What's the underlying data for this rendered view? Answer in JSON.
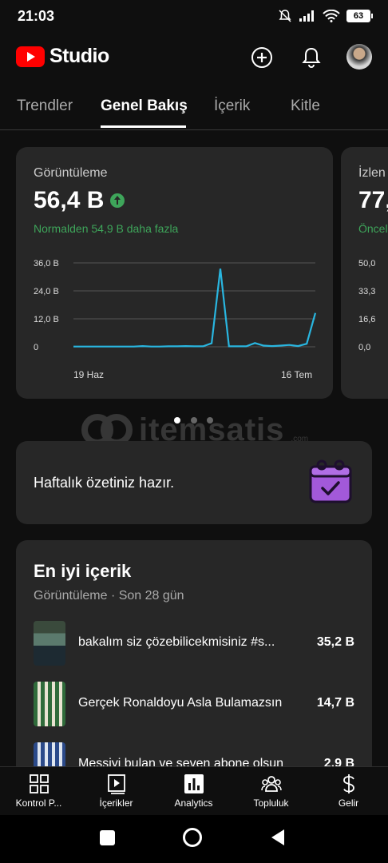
{
  "status": {
    "time": "21:03",
    "battery": "63"
  },
  "header": {
    "logo_text": "Studio"
  },
  "tabs": [
    {
      "label": "Trendler"
    },
    {
      "label": "Genel Bakış"
    },
    {
      "label": "İçerik"
    },
    {
      "label": "Kitle"
    }
  ],
  "views_card": {
    "label": "Görüntüleme",
    "value": "56,4 B",
    "note": "Normalden 54,9 B daha fazla"
  },
  "peek_card": {
    "label": "İzlen",
    "value": "77,",
    "note": "Öncel"
  },
  "chart_data": [
    {
      "type": "line",
      "title": "",
      "x_start_label": "19 Haz",
      "x_end_label": "16 Tem",
      "y_ticks": [
        "0",
        "12,0 B",
        "24,0 B",
        "36,0 B"
      ],
      "ylim": [
        0,
        36
      ],
      "grid": true,
      "color": "#29b6e0",
      "series": [
        {
          "values": [
            0.1,
            0.1,
            0.1,
            0.1,
            0.1,
            0.1,
            0.1,
            0.1,
            0.3,
            0.1,
            0.1,
            0.2,
            0.2,
            0.3,
            0.2,
            0.2,
            1.5,
            33.5,
            0.2,
            0.2,
            0.2,
            1.6,
            0.5,
            0.3,
            0.5,
            0.8,
            0.3,
            1.3,
            14.5
          ]
        }
      ]
    },
    {
      "type": "line",
      "y_ticks": [
        "0,0",
        "16,6",
        "33,3",
        "50,0"
      ],
      "ylim": [
        0,
        50
      ]
    }
  ],
  "pager": {
    "count": 3,
    "active": 0
  },
  "watermark": {
    "text": "itemsatis",
    "small": ".com"
  },
  "weekly": {
    "text": "Haftalık özetiniz hazır."
  },
  "top_content": {
    "title": "En iyi içerik",
    "subtitle": "Görüntüleme · Son 28 gün",
    "items": [
      {
        "title": "bakalım siz çözebilicekmisiniz #s...",
        "value": "35,2 B"
      },
      {
        "title": "Gerçek Ronaldoyu Asla Bulamazsın",
        "value": "14,7 B"
      },
      {
        "title": "Messiyi bulan ve seven abone olsun",
        "value": "2,9 B"
      }
    ]
  },
  "bottom_nav": [
    {
      "label": "Kontrol P...",
      "icon": "dashboard-icon"
    },
    {
      "label": "İçerikler",
      "icon": "content-icon"
    },
    {
      "label": "Analytics",
      "icon": "analytics-icon"
    },
    {
      "label": "Topluluk",
      "icon": "community-icon"
    },
    {
      "label": "Gelir",
      "icon": "dollar-icon"
    }
  ]
}
